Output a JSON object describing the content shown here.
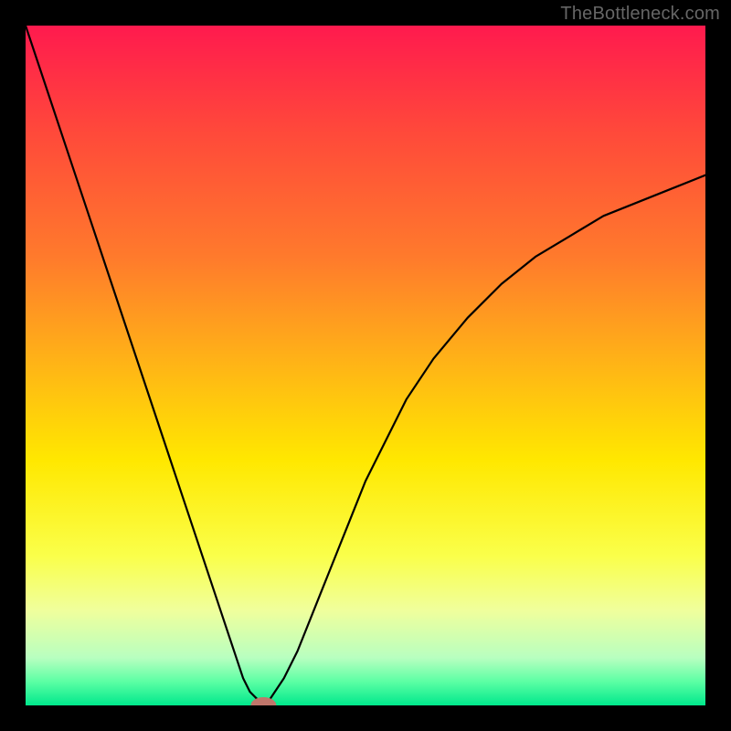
{
  "watermark": "TheBottleneck.com",
  "chart_data": {
    "type": "line",
    "title": "",
    "xlabel": "",
    "ylabel": "",
    "xlim": [
      0,
      100
    ],
    "ylim": [
      0,
      100
    ],
    "grid": false,
    "legend": false,
    "background_gradient": {
      "stops": [
        {
          "t": 0.0,
          "color": "#ff1a4e"
        },
        {
          "t": 0.16,
          "color": "#ff4a3a"
        },
        {
          "t": 0.34,
          "color": "#ff7a2c"
        },
        {
          "t": 0.5,
          "color": "#ffb516"
        },
        {
          "t": 0.64,
          "color": "#ffe800"
        },
        {
          "t": 0.78,
          "color": "#faff4a"
        },
        {
          "t": 0.86,
          "color": "#f0ff9c"
        },
        {
          "t": 0.93,
          "color": "#b8ffc0"
        },
        {
          "t": 0.965,
          "color": "#5cffa4"
        },
        {
          "t": 1.0,
          "color": "#00e88c"
        }
      ]
    },
    "series": [
      {
        "name": "bottleneck-curve",
        "x": [
          0,
          2,
          4,
          6,
          8,
          10,
          12,
          14,
          16,
          18,
          20,
          22,
          24,
          26,
          28,
          30,
          31,
          32,
          33,
          34,
          35,
          36,
          38,
          40,
          42,
          44,
          46,
          48,
          50,
          53,
          56,
          60,
          65,
          70,
          75,
          80,
          85,
          90,
          95,
          100
        ],
        "values": [
          100,
          94,
          88,
          82,
          76,
          70,
          64,
          58,
          52,
          46,
          40,
          34,
          28,
          22,
          16,
          10,
          7,
          4,
          2,
          1,
          0,
          1,
          4,
          8,
          13,
          18,
          23,
          28,
          33,
          39,
          45,
          51,
          57,
          62,
          66,
          69,
          72,
          74,
          76,
          78
        ]
      }
    ],
    "marker_points": [
      {
        "x": 35,
        "y": 0,
        "color": "#c0766b"
      }
    ]
  }
}
